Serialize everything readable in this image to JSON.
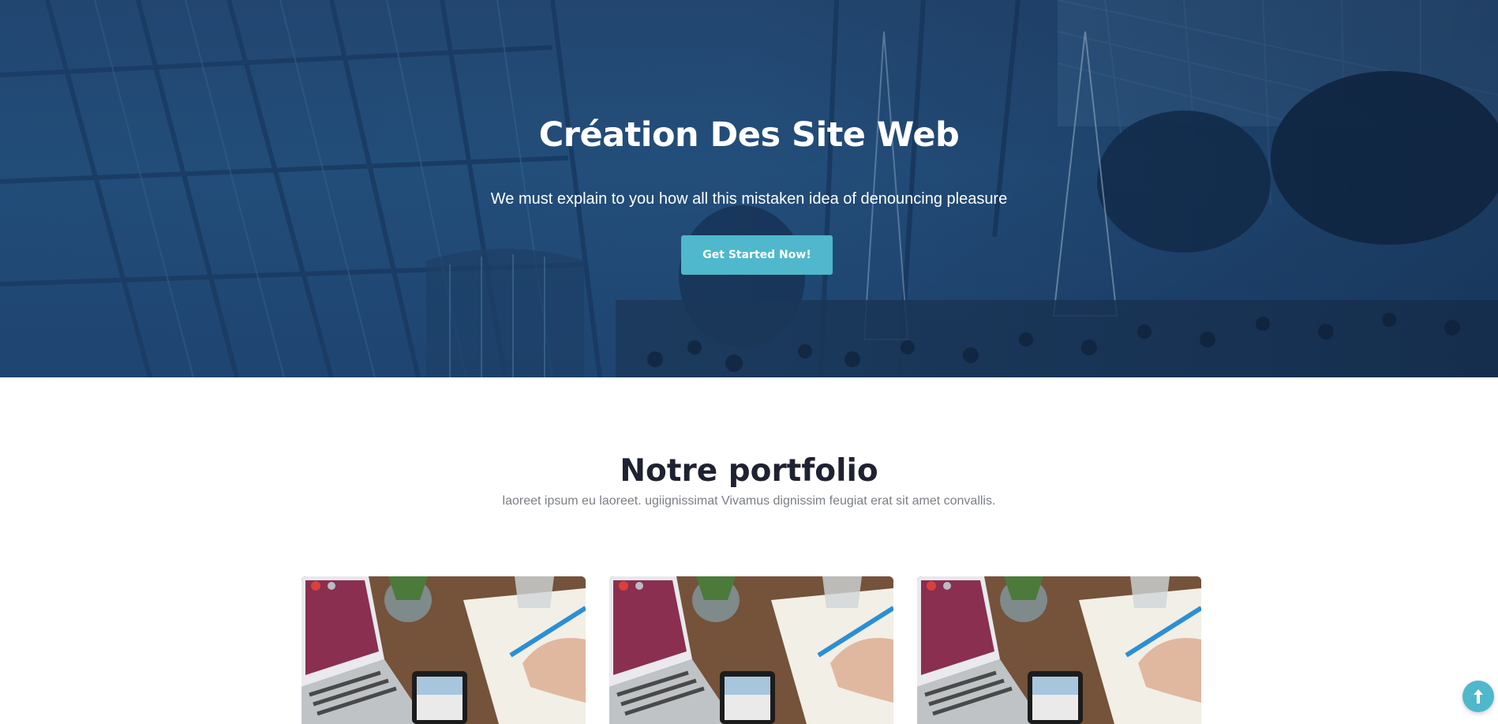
{
  "hero": {
    "title": "Création Des Site Web",
    "subtitle": "We must explain to you how all this mistaken idea of denouncing pleasure",
    "cta_label": "Get Started Now!"
  },
  "portfolio": {
    "title": "Notre portfolio",
    "subtitle": "laoreet ipsum eu laoreet. ugiignissimat Vivamus dignissim feugiat erat sit amet convallis.",
    "items": [
      {
        "image": "laptop-desk-photo"
      },
      {
        "image": "laptop-desk-photo"
      },
      {
        "image": "laptop-desk-photo"
      }
    ]
  },
  "colors": {
    "hero_overlay": "#24507c",
    "accent": "#4fb8cc",
    "heading": "#1f2230",
    "muted_text": "#7b7f86"
  },
  "icons": {
    "back_to_top": "arrow-up-icon"
  }
}
